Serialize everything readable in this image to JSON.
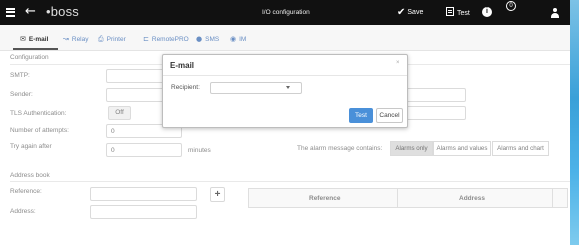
{
  "topbar": {
    "logo": "•boss",
    "title": "I/O configuration",
    "save_label": "Save",
    "test_label": "Test",
    "notification_count": "0"
  },
  "tabs": [
    {
      "label": "E-mail",
      "icon": "envelope-icon",
      "active": true
    },
    {
      "label": "Relay",
      "icon": "relay-icon",
      "active": false
    },
    {
      "label": "Printer",
      "icon": "printer-icon",
      "active": false
    },
    {
      "label": "RemotePRO",
      "icon": "remote-icon",
      "active": false
    },
    {
      "label": "SMS",
      "icon": "sms-icon",
      "active": false
    },
    {
      "label": "IM",
      "icon": "im-icon",
      "active": false
    }
  ],
  "configuration": {
    "section_title": "Configuration",
    "smtp_label": "SMTP:",
    "smtp_value": "",
    "sender_label": "Sender:",
    "sender_value": "",
    "tls_label": "TLS Authentication:",
    "tls_value": "Off",
    "attempts_label": "Number of attempts:",
    "attempts_value": "0",
    "retry_label": "Try again after",
    "retry_value": "0",
    "retry_unit": "minutes",
    "right_field_1": "",
    "right_field_2": "",
    "alarm_label": "The alarm message contains:",
    "alarm_options": [
      "Alarms only",
      "Alarms and values",
      "Alarms and chart"
    ],
    "alarm_selected": "Alarms only"
  },
  "address_book": {
    "section_title": "Address book",
    "reference_label": "Reference:",
    "reference_value": "",
    "address_label": "Address:",
    "address_value": "",
    "add_label": "+",
    "columns": [
      "Reference",
      "Address"
    ]
  },
  "modal": {
    "title": "E-mail",
    "close_label": "×",
    "recipient_label": "Recipient:",
    "recipient_value": "",
    "test_label": "Test",
    "cancel_label": "Cancel"
  },
  "colors": {
    "topbar_bg": "#111111",
    "tab_link": "#6a8fc4",
    "primary_button": "#4a90d9",
    "accent_strip": "#3aa0d8"
  }
}
